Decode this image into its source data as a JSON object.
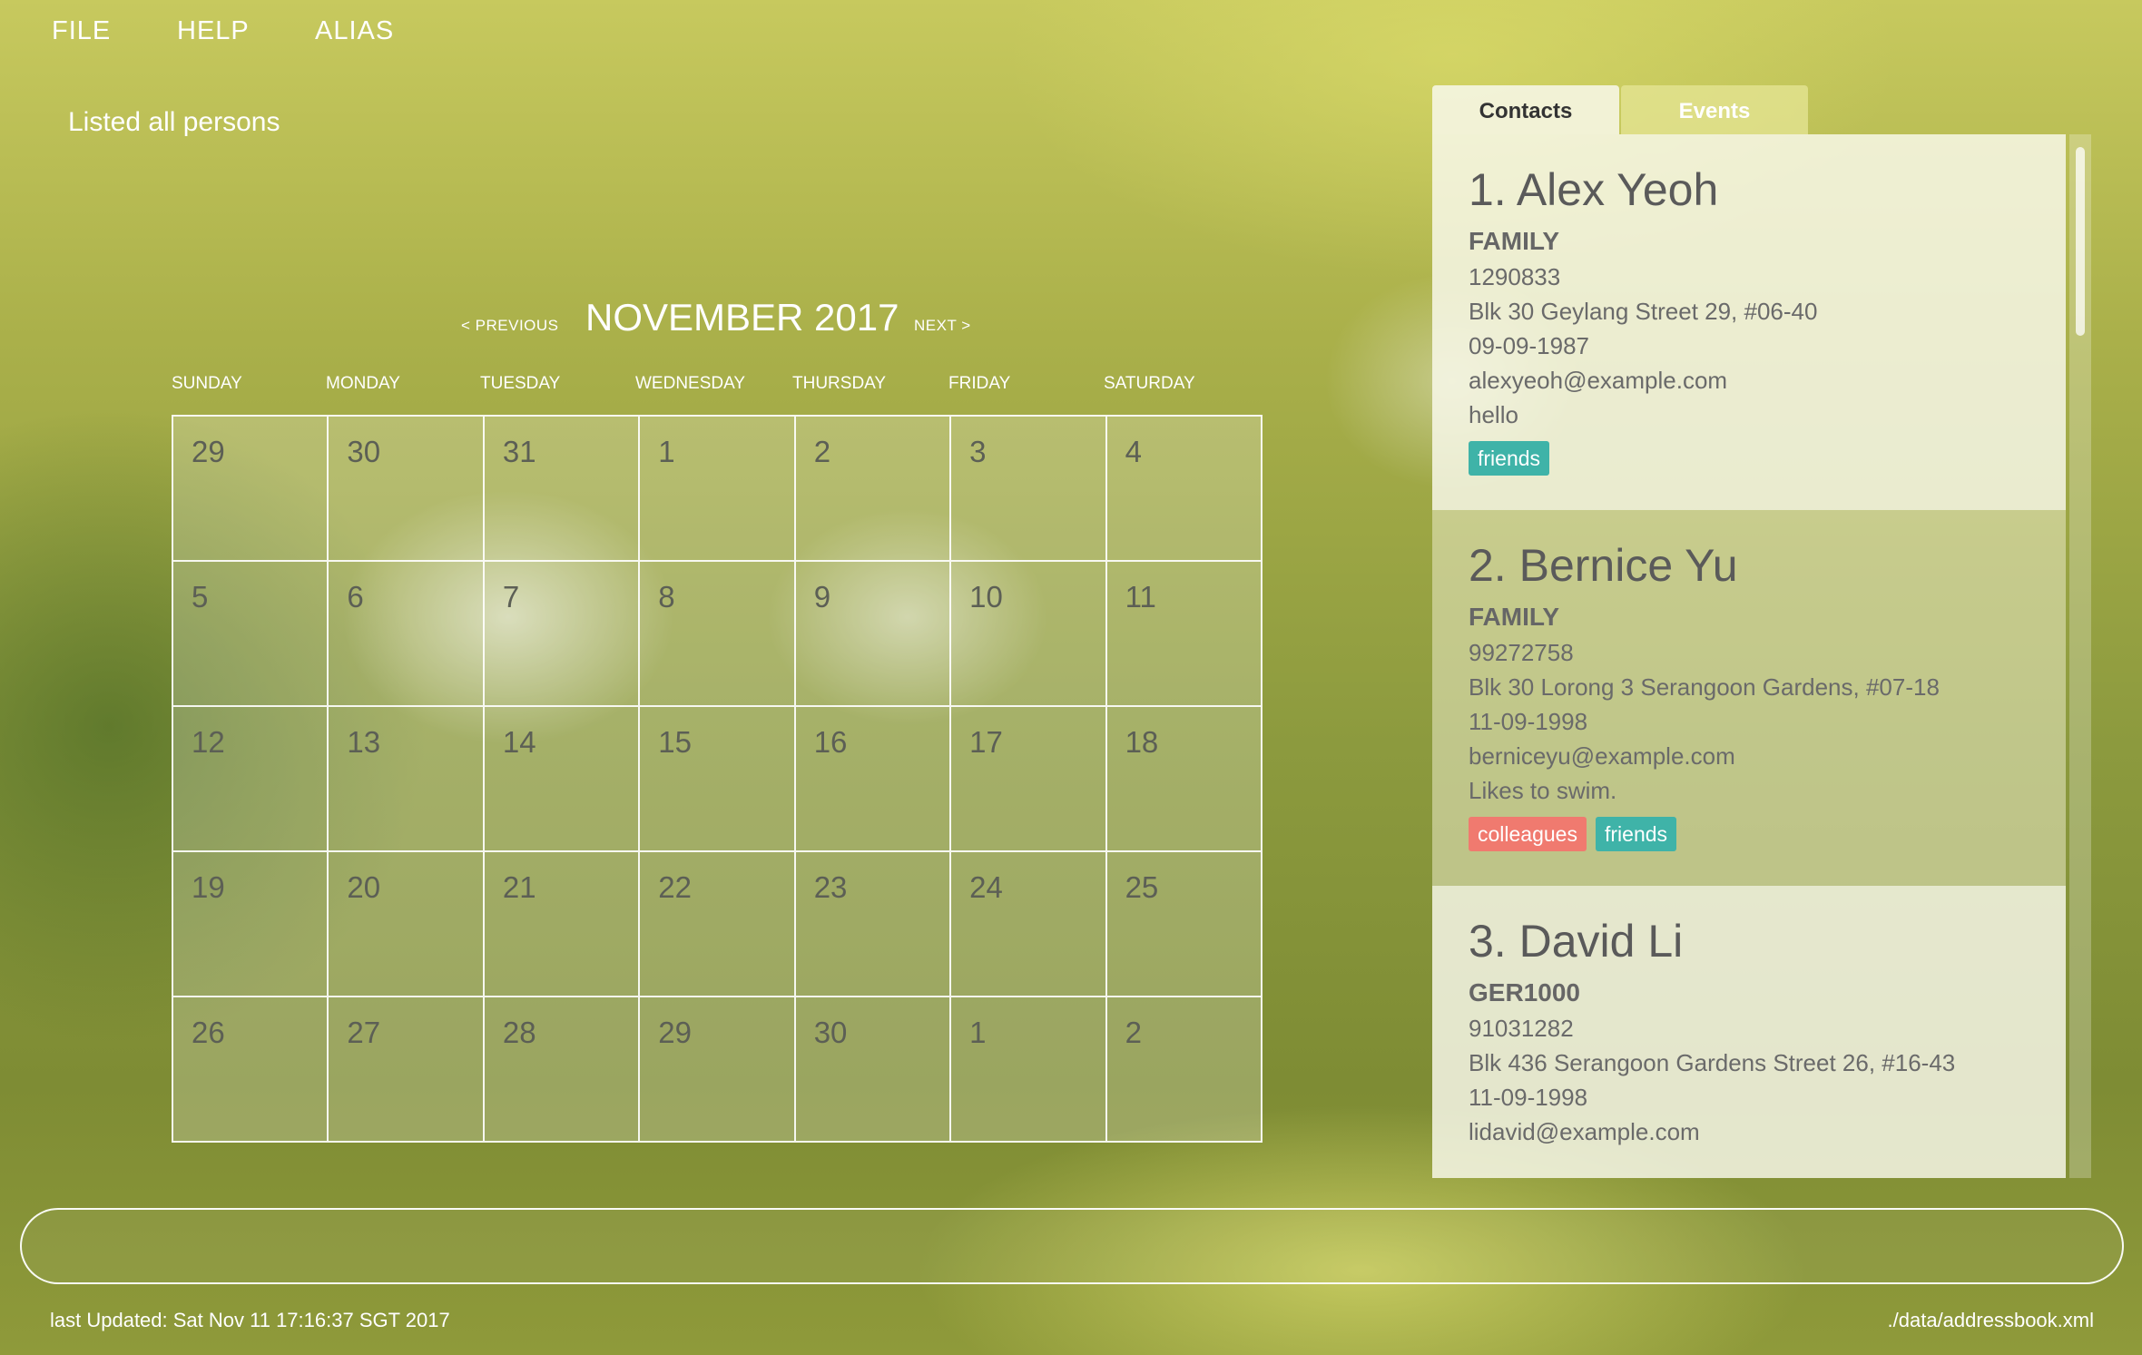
{
  "menu": {
    "file": "FILE",
    "help": "HELP",
    "alias": "ALIAS"
  },
  "status_message": "Listed all persons",
  "calendar": {
    "prev": "< PREVIOUS",
    "title": "NOVEMBER 2017",
    "next": "NEXT >",
    "weekdays": [
      "SUNDAY",
      "MONDAY",
      "TUESDAY",
      "WEDNESDAY",
      "THURSDAY",
      "FRIDAY",
      "SATURDAY"
    ],
    "dates": [
      "29",
      "30",
      "31",
      "1",
      "2",
      "3",
      "4",
      "5",
      "6",
      "7",
      "8",
      "9",
      "10",
      "11",
      "12",
      "13",
      "14",
      "15",
      "16",
      "17",
      "18",
      "19",
      "20",
      "21",
      "22",
      "23",
      "24",
      "25",
      "26",
      "27",
      "28",
      "29",
      "30",
      "1",
      "2"
    ]
  },
  "tabs": {
    "contacts": "Contacts",
    "events": "Events"
  },
  "contacts": [
    {
      "name": "1. Alex Yeoh",
      "group": "FAMILY",
      "phone": "1290833",
      "address": "Blk 30 Geylang Street 29, #06-40",
      "birthday": "09-09-1987",
      "email": "alexyeoh@example.com",
      "remark": "hello",
      "tags": [
        {
          "label": "friends",
          "color": "#3fb3a8"
        }
      ]
    },
    {
      "name": "2. Bernice Yu",
      "group": "FAMILY",
      "phone": "99272758",
      "address": "Blk 30 Lorong 3 Serangoon Gardens, #07-18",
      "birthday": "11-09-1998",
      "email": "berniceyu@example.com",
      "remark": "Likes to swim.",
      "tags": [
        {
          "label": "colleagues",
          "color": "#f07a6f"
        },
        {
          "label": "friends",
          "color": "#3fb3a8"
        }
      ]
    },
    {
      "name": "3. David Li",
      "group": "GER1000",
      "phone": "91031282",
      "address": "Blk 436 Serangoon Gardens Street 26, #16-43",
      "birthday": "11-09-1998",
      "email": "lidavid@example.com"
    }
  ],
  "command": {
    "value": "",
    "placeholder": ""
  },
  "footer": {
    "last_updated": "last Updated: Sat Nov 11 17:16:37 SGT 2017",
    "file_path": "./data/addressbook.xml"
  }
}
